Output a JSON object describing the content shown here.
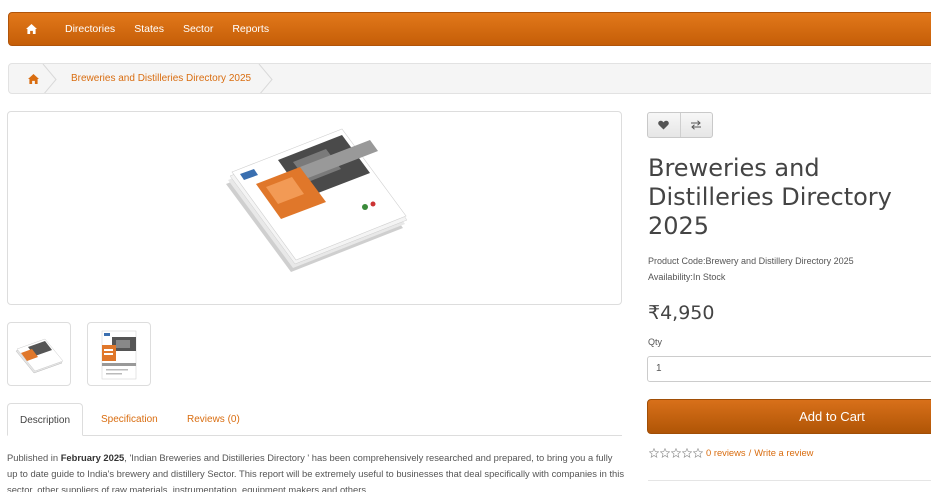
{
  "nav": {
    "items": [
      "Directories",
      "States",
      "Sector",
      "Reports"
    ]
  },
  "breadcrumb": {
    "current": "Breweries and Distilleries Directory 2025"
  },
  "tabs": {
    "description": "Description",
    "specification": "Specification",
    "reviews": "Reviews (0)"
  },
  "description": {
    "prefix": "Published in ",
    "month": "February 2025",
    "body": ", 'Indian Breweries and Distilleries Directory ' has been comprehensively researched and prepared, to bring you a fully up to date guide to India's brewery and distillery Sector. This report will be extremely useful to businesses that deal specifically with companies in this sector, other suppliers of raw materials, instrumentation, equipment makers and others"
  },
  "product": {
    "title": "Breweries and Distilleries Directory 2025",
    "code_label": "Product Code:",
    "code": "Brewery and Distillery Directory 2025",
    "availability_label": "Availability:",
    "availability": "In Stock",
    "price": "₹4,950",
    "qty_label": "Qty",
    "qty_value": "1",
    "add_to_cart": "Add to Cart"
  },
  "reviews": {
    "count_text": "0 reviews",
    "separator": "/",
    "write_text": "Write a review"
  },
  "icons": {
    "home": "home-icon",
    "wishlist": "heart-icon",
    "compare": "exchange-icon",
    "star": "star-outline-icon"
  },
  "colors": {
    "accent": "#d96d10",
    "nav_bg": "#d26a12",
    "button_bg": "#c4620d"
  }
}
